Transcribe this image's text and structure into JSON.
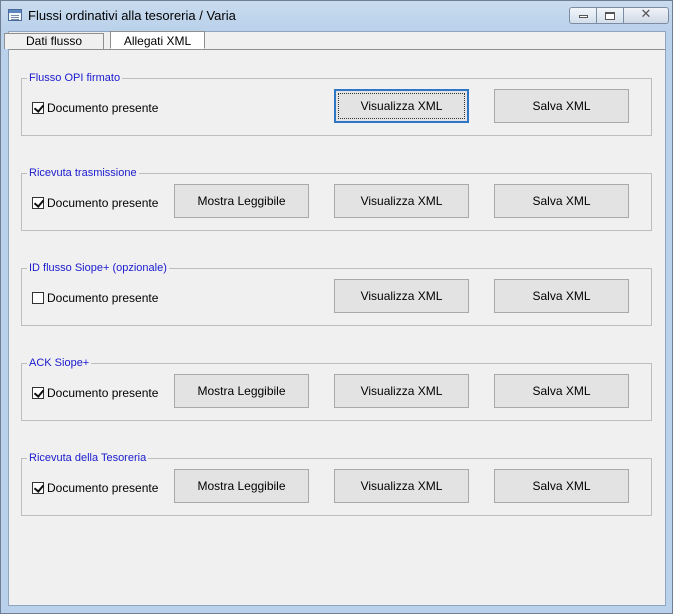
{
  "window": {
    "title": "Flussi ordinativi alla tesoreria / Varia",
    "controls": {
      "minimize": "minimize",
      "maximize": "maximize",
      "close": "✕"
    }
  },
  "tabs": [
    {
      "label": "Dati flusso",
      "selected": false
    },
    {
      "label": "Allegati XML",
      "selected": true
    }
  ],
  "groups": [
    {
      "legend": "Flusso OPI firmato",
      "checkbox_label": "Documento presente",
      "checked": true,
      "buttons": {
        "visualizza": "Visualizza XML",
        "salva": "Salva XML"
      }
    },
    {
      "legend": "Ricevuta trasmissione",
      "checkbox_label": "Documento presente",
      "checked": true,
      "buttons": {
        "mostra": "Mostra Leggibile",
        "visualizza": "Visualizza XML",
        "salva": "Salva XML"
      }
    },
    {
      "legend": "ID flusso Siope+ (opzionale)",
      "checkbox_label": "Documento presente",
      "checked": false,
      "buttons": {
        "visualizza": "Visualizza XML",
        "salva": "Salva XML"
      }
    },
    {
      "legend": "ACK Siope+",
      "checkbox_label": "Documento presente",
      "checked": true,
      "buttons": {
        "mostra": "Mostra Leggibile",
        "visualizza": "Visualizza XML",
        "salva": "Salva XML"
      }
    },
    {
      "legend": "Ricevuta della Tesoreria",
      "checkbox_label": "Documento presente",
      "checked": true,
      "buttons": {
        "mostra": "Mostra Leggibile",
        "visualizza": "Visualizza XML",
        "salva": "Salva XML"
      }
    }
  ],
  "colors": {
    "legend": "#1a1acf",
    "focus": "#2f76c4",
    "client_bg": "#f0f0f0"
  }
}
